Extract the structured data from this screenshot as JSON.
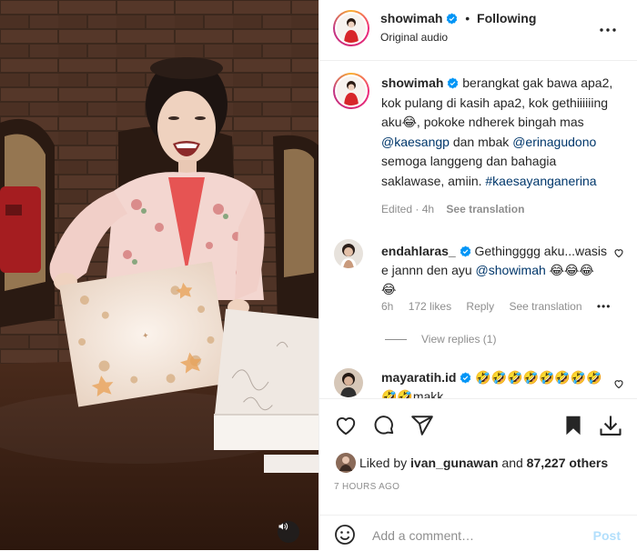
{
  "header": {
    "username": "showimah",
    "dot": "•",
    "following": "Following",
    "subtitle": "Original audio"
  },
  "caption": {
    "username": "showimah",
    "text_1": " berangkat gak bawa apa2, kok pulang di kasih apa2, kok gethiiiiiing aku😂, pokoke ndherek bingah mas ",
    "mention_1": "@kaesangp",
    "text_2": " dan mbak ",
    "mention_2": "@erinagudono",
    "text_3": " semoga langgeng dan bahagia saklawase, amiin. ",
    "hashtag": "#kaesayanganerina",
    "edited": "Edited · 4h",
    "see_translation": "See translation"
  },
  "comments": [
    {
      "username": "endahlaras_",
      "text": " Gethingggg aku...wasis e jannn den ayu ",
      "mention": "@showimah",
      "emoji": " 😂😂😂😂",
      "age": "6h",
      "likes": "172 likes",
      "reply": "Reply",
      "see_translation": "See translation",
      "view_replies": "View replies (1)"
    },
    {
      "username": "mayaratih.id",
      "text": " 🤣🤣🤣🤣🤣🤣🤣🤣🤣🤣makk"
    }
  ],
  "likes": {
    "prefix": "Liked by ",
    "user": "ivan_gunawan",
    "middle": " and ",
    "count": "87,227 others"
  },
  "timestamp": "7 HOURS AGO",
  "add_comment": {
    "placeholder": "Add a comment…",
    "post": "Post"
  },
  "colors": {
    "verified": "#0095f6",
    "mention": "#00376b",
    "post_disabled": "#b2dffc"
  }
}
